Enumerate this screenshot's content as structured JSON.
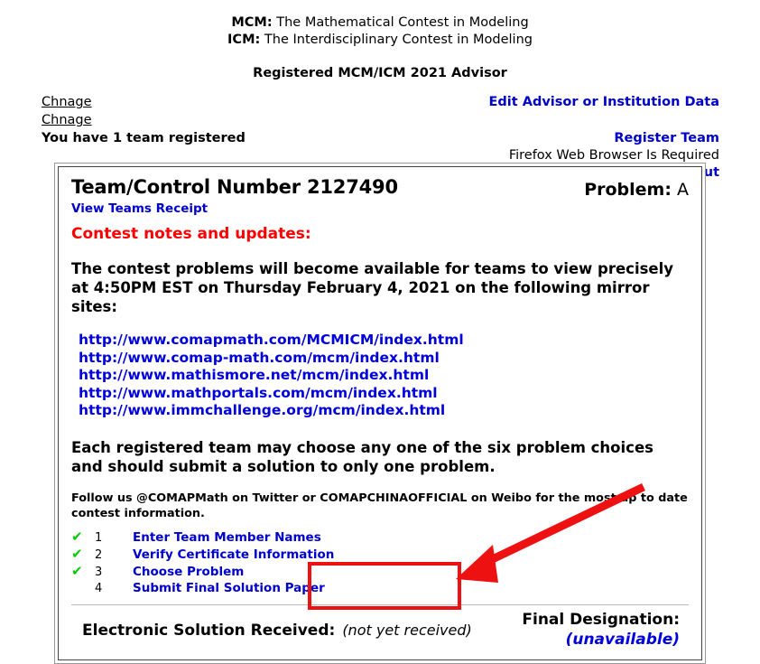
{
  "masthead": {
    "line1_prefix": "MCM:",
    "line1_text": " The Mathematical Contest in Modeling",
    "line2_prefix": "ICM:",
    "line2_text": " The Interdisciplinary Contest in Modeling",
    "subtitle": "Registered MCM/ICM 2021 Advisor"
  },
  "account": {
    "change_advisor": "Chnage",
    "change_institution": "Chnage",
    "team_count_text": "You have 1 team registered",
    "edit_link": "Edit Advisor or Institution Data",
    "register_team_link": "Register Team",
    "browser_note": "Firefox Web Browser Is Required",
    "logout_link": "Logout"
  },
  "panel": {
    "team_number_label": "Team/Control Number 2127490",
    "receipt_link": "View Teams Receipt",
    "problem_label": "Problem:",
    "problem_value": "A",
    "notes_heading": "Contest notes and updates:",
    "availability_text": "The contest problems will become available for teams to view precisely at 4:50PM EST on Thursday February 4, 2021 on the following mirror sites:",
    "mirror_sites": [
      "http://www.comapmath.com/MCMICM/index.html",
      "http://www.comap-math.com/mcm/index.html",
      "http://www.mathismore.net/mcm/index.html",
      "http://www.mathportals.com/mcm/index.html",
      "http://www.immchallenge.org/mcm/index.html"
    ],
    "choice_note": "Each registered team may choose any one of the six problem choices and should submit a solution to only one problem.",
    "follow_note": "Follow us @COMAPMath on Twitter or COMAPCHINAOFFICIAL on Weibo for the most up to date contest information.",
    "tasks": [
      {
        "check": "✔",
        "number": "1",
        "label": "Enter Team Member Names",
        "done": true
      },
      {
        "check": "✔",
        "number": "2",
        "label": "Verify Certificate Information",
        "done": true
      },
      {
        "check": "✔",
        "number": "3",
        "label": "Choose Problem",
        "done": true
      },
      {
        "check": "",
        "number": "4",
        "label": "Submit Final Solution Paper",
        "done": false
      }
    ],
    "status": {
      "solution_label": "Electronic Solution Received:",
      "solution_value": "(not yet received)",
      "designation_label": "Final Designation:",
      "designation_value": "(unavailable)"
    }
  },
  "annotation": {
    "highlight_color": "#EE1111",
    "arrow_color": "#EE1111",
    "target": "(not yet received)"
  }
}
